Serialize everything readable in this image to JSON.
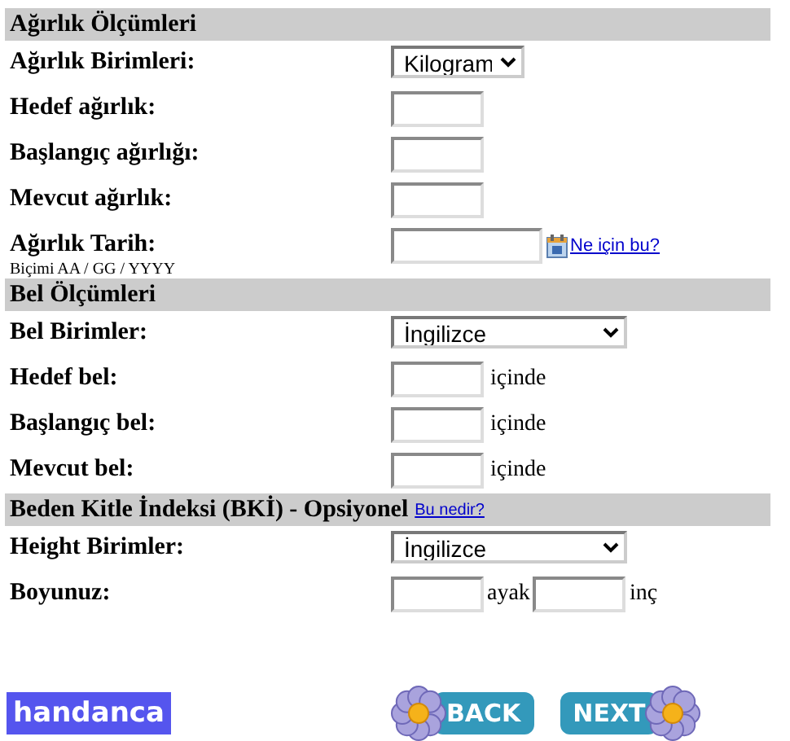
{
  "sections": [
    {
      "title": "Ağırlık Ölçümleri",
      "rows": [
        {
          "kind": "select",
          "label": "Ağırlık Birimleri:",
          "value": "Kilogram"
        },
        {
          "kind": "input",
          "label": "Hedef ağırlık:"
        },
        {
          "kind": "input",
          "label": "Başlangıç ağırlığı:"
        },
        {
          "kind": "input",
          "label": "Mevcut ağırlık:"
        },
        {
          "kind": "date",
          "label": "Ağırlık Tarih:",
          "hint": "Biçimi AA / GG / YYYY",
          "link": "Ne için bu?"
        }
      ]
    },
    {
      "title": "Bel Ölçümleri",
      "rows": [
        {
          "kind": "select",
          "label": "Bel Birimler:",
          "value": "İngilizce"
        },
        {
          "kind": "input",
          "label": "Hedef bel:",
          "unit": "içinde"
        },
        {
          "kind": "input",
          "label": "Başlangıç bel:",
          "unit": "içinde"
        },
        {
          "kind": "input",
          "label": "Mevcut bel:",
          "unit": "içinde"
        }
      ]
    },
    {
      "title": "Beden Kitle İndeksi (BKİ) - Opsiyonel",
      "link": "Bu nedir?",
      "rows": [
        {
          "kind": "select",
          "label": "Height Birimler:",
          "value": "İngilizce"
        },
        {
          "kind": "height",
          "label": "Boyunuz:",
          "units": [
            "ayak",
            "inç"
          ]
        }
      ]
    }
  ],
  "footer": {
    "logo": "handanca",
    "buttons": [
      {
        "kind": "back",
        "label": "BACK"
      },
      {
        "kind": "next",
        "label": "NEXT"
      }
    ]
  }
}
